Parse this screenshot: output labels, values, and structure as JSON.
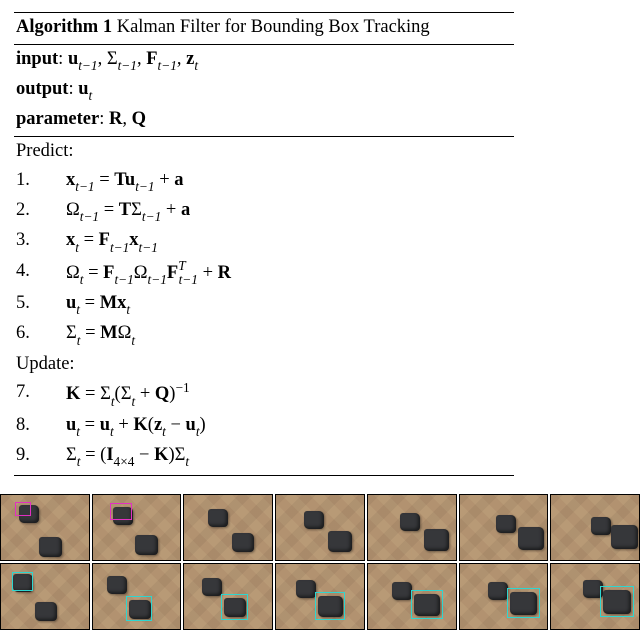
{
  "algorithm": {
    "title_prefix": "Algorithm 1",
    "title_rest": " Kalman Filter for Bounding Box Tracking",
    "input_label": "input",
    "input_vars": ": 𝐮",
    "output_label": "output",
    "output_vars": ": 𝐮",
    "parameter_label": "parameter",
    "parameter_vars": ": 𝐑, 𝐐",
    "predict_label": "Predict:",
    "update_label": "Update:",
    "steps": {
      "n1": "1.",
      "n2": "2.",
      "n3": "3.",
      "n4": "4.",
      "n5": "5.",
      "n6": "6.",
      "n7": "7.",
      "n8": "8.",
      "n9": "9."
    }
  },
  "colors": {
    "magenta": "#e22fc1",
    "cyan": "#2ed6d0"
  },
  "figure": {
    "rows": 2,
    "cols": 7,
    "row1_box_color": "magenta",
    "row2_box_color": "cyan",
    "description": "Two rows of seven simulation frames showing UAV view over a tiled brown floor with dark rocks. Top row: magenta bounding boxes track a rock. Bottom row: cyan bounding boxes track a rock."
  }
}
